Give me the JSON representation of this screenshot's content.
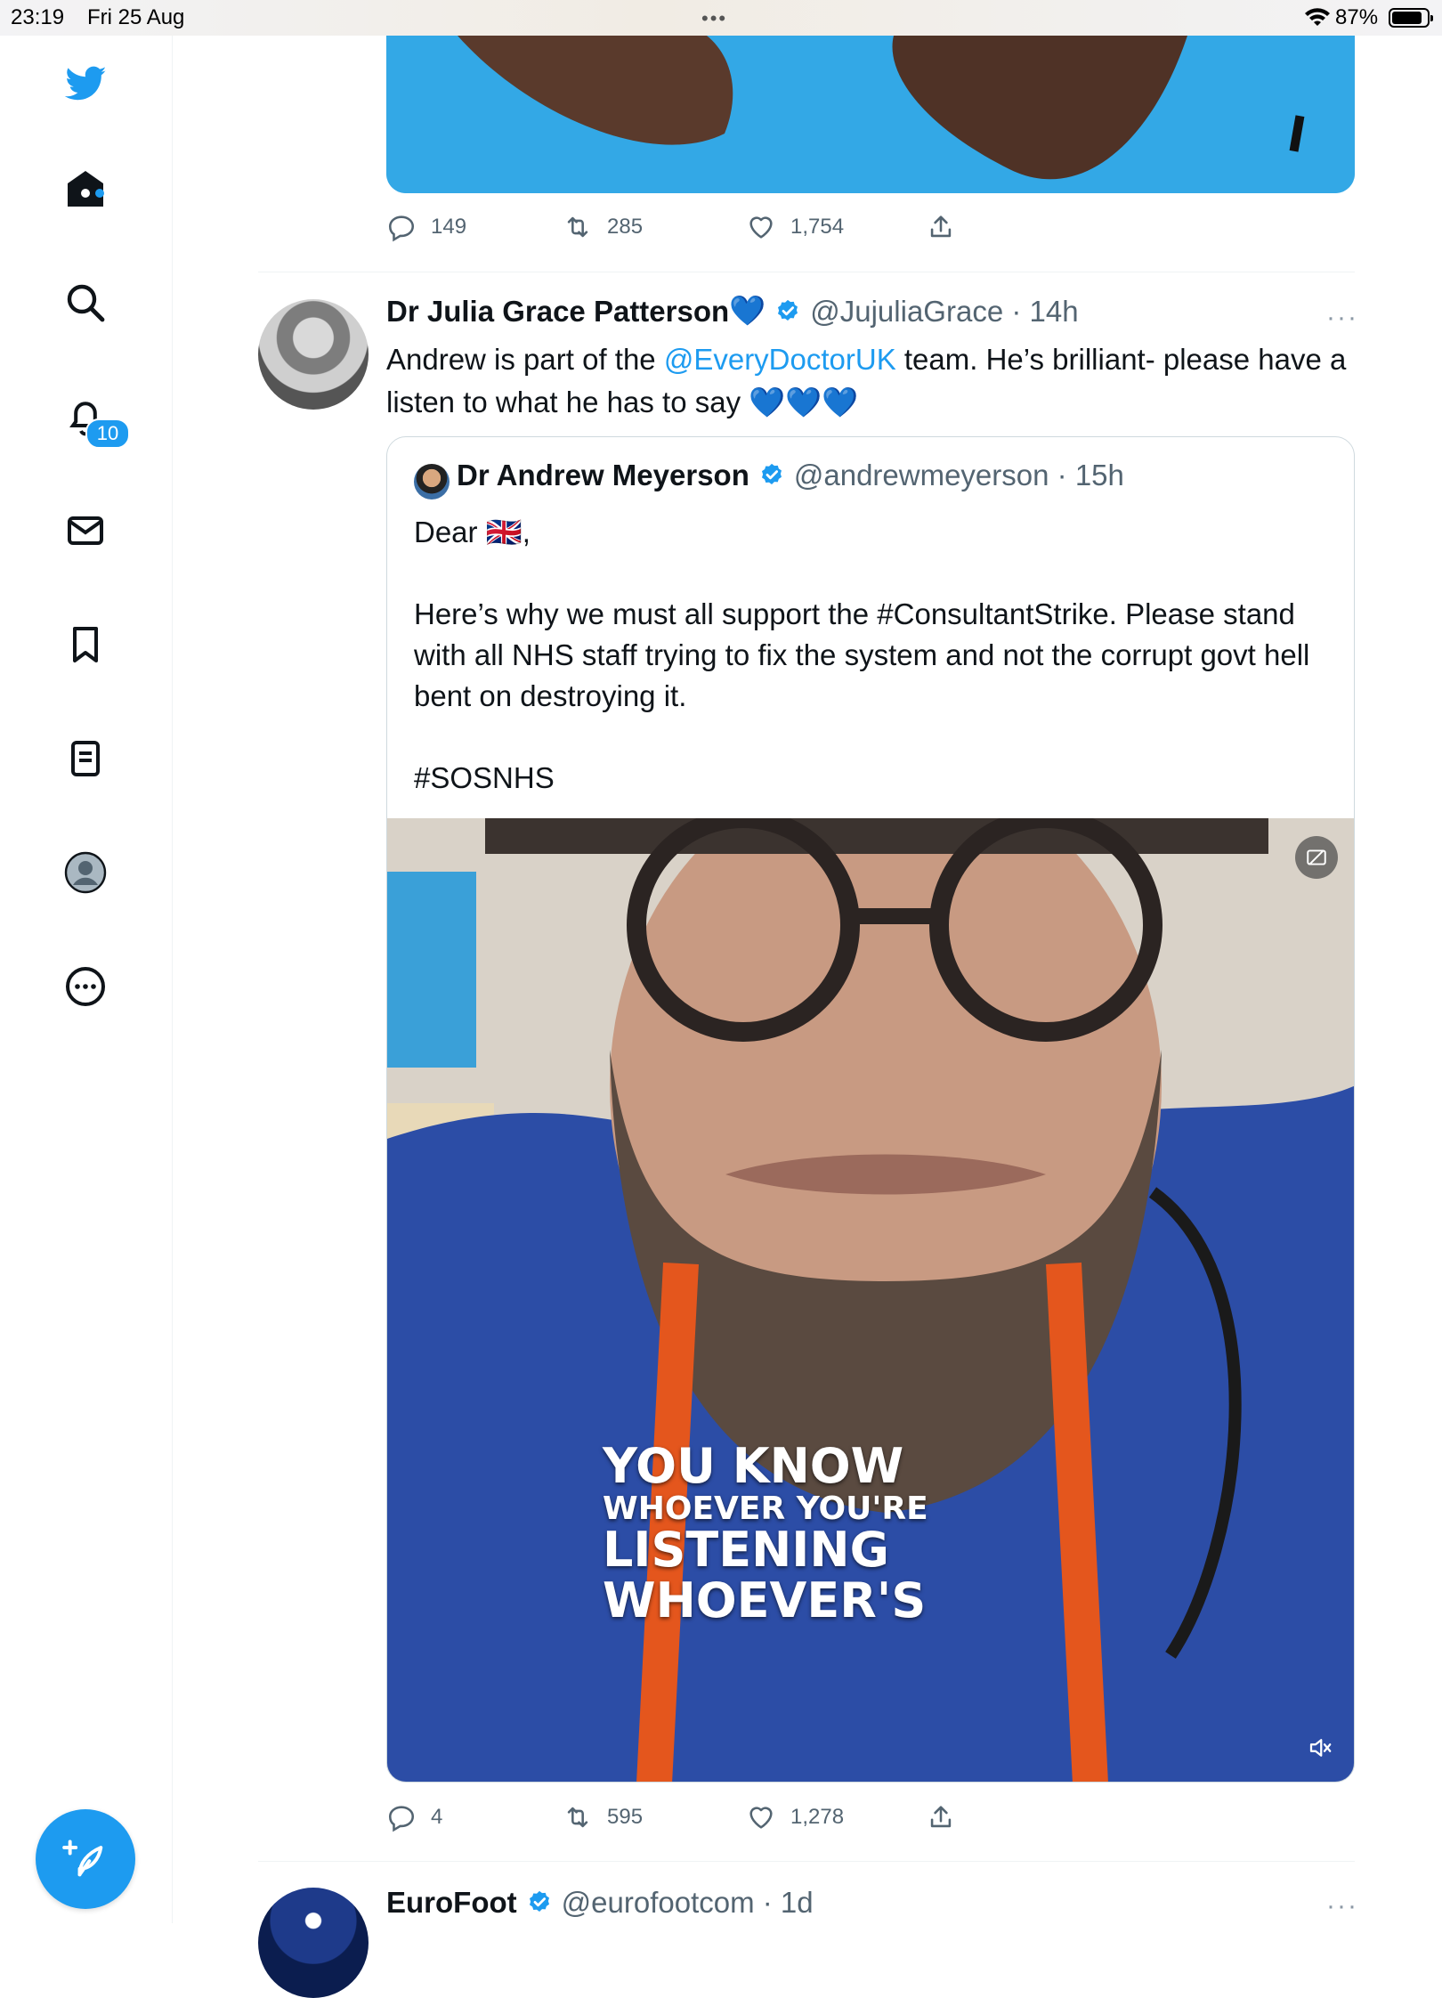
{
  "status_bar": {
    "time": "23:19",
    "date": "Fri 25 Aug",
    "battery": "87%",
    "battery_level": 0.87
  },
  "sidebar": {
    "items": [
      {
        "icon": "twitter-logo-icon"
      },
      {
        "icon": "home-icon"
      },
      {
        "icon": "search-icon"
      },
      {
        "icon": "notifications-icon",
        "badge": "10"
      },
      {
        "icon": "messages-icon"
      },
      {
        "icon": "bookmarks-icon"
      },
      {
        "icon": "lists-icon"
      },
      {
        "icon": "profile-icon"
      },
      {
        "icon": "more-icon"
      }
    ],
    "compose_icon": "compose-tweet-icon"
  },
  "prev_tweet": {
    "replies": "149",
    "retweets": "285",
    "likes": "1,754"
  },
  "tweet": {
    "name": "Dr Julia Grace Patterson",
    "name_emoji": "💙",
    "handle": "@JujuliaGrace",
    "time": "14h",
    "text_before_link": "Andrew is part of the ",
    "link": "@EveryDoctorUK",
    "text_after_link": " team. He’s brilliant- please have a listen to what he has to say 💙💙💙",
    "replies": "4",
    "retweets": "595",
    "likes": "1,278"
  },
  "quote": {
    "name": "Dr Andrew Meyerson",
    "handle": "@andrewmeyerson",
    "time": "15h",
    "text": "Dear 🇬🇧,\n\nHere’s why we must all support the #ConsultantStrike. Please stand with all NHS staff trying to fix the system and not the corrupt govt hell bent on destroying it.\n\n#SOSNHS",
    "video_caption": [
      "YOU KNOW",
      "WHOEVER YOU'RE",
      "LISTENING",
      "WHOEVER'S"
    ]
  },
  "next_tweet": {
    "name": "EuroFoot",
    "handle": "@eurofootcom",
    "time": "1d"
  },
  "colors": {
    "accent": "#1d9bf0",
    "text": "#0f1419",
    "secondary": "#536471"
  }
}
